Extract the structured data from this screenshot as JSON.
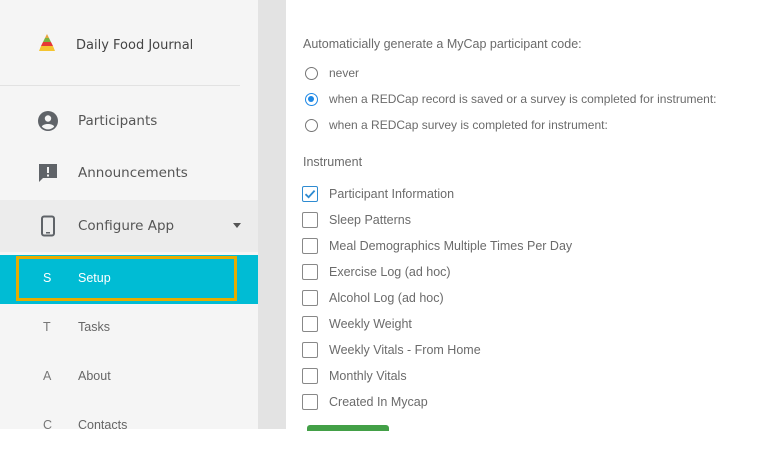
{
  "sidebar": {
    "app_title": "Daily Food Journal",
    "app_icon": "food-pyramid-icon",
    "nav": [
      {
        "label": "Participants",
        "icon": "person-circle-icon"
      },
      {
        "label": "Announcements",
        "icon": "announcement-icon"
      },
      {
        "label": "Configure App",
        "icon": "phone-icon"
      }
    ],
    "sub_items": [
      {
        "letter": "S",
        "label": "Setup",
        "active": true
      },
      {
        "letter": "T",
        "label": "Tasks",
        "active": false
      },
      {
        "letter": "A",
        "label": "About",
        "active": false
      },
      {
        "letter": "C",
        "label": "Contacts",
        "active": false
      }
    ]
  },
  "main": {
    "intro": "Automaticially generate a MyCap participant code:",
    "options": [
      {
        "label": "never",
        "selected": false
      },
      {
        "label": "when a REDCap record is saved or a survey is completed for instrument:",
        "selected": true
      },
      {
        "label": "when a REDCap survey is completed for instrument:",
        "selected": false
      }
    ],
    "instrument_heading": "Instrument",
    "instruments": [
      {
        "label": "Participant Information",
        "checked": true
      },
      {
        "label": "Sleep Patterns",
        "checked": false
      },
      {
        "label": "Meal Demographics Multiple Times Per Day",
        "checked": false
      },
      {
        "label": "Exercise Log (ad hoc)",
        "checked": false
      },
      {
        "label": "Alcohol Log (ad hoc)",
        "checked": false
      },
      {
        "label": "Weekly Weight",
        "checked": false
      },
      {
        "label": "Weekly Vitals - From Home",
        "checked": false
      },
      {
        "label": "Monthly Vitals",
        "checked": false
      },
      {
        "label": "Created In Mycap",
        "checked": false
      }
    ]
  },
  "colors": {
    "accent": "#00bcd4",
    "highlight": "#e6ac00",
    "radio_selected": "#1e88e5",
    "save_button": "#43a047"
  }
}
